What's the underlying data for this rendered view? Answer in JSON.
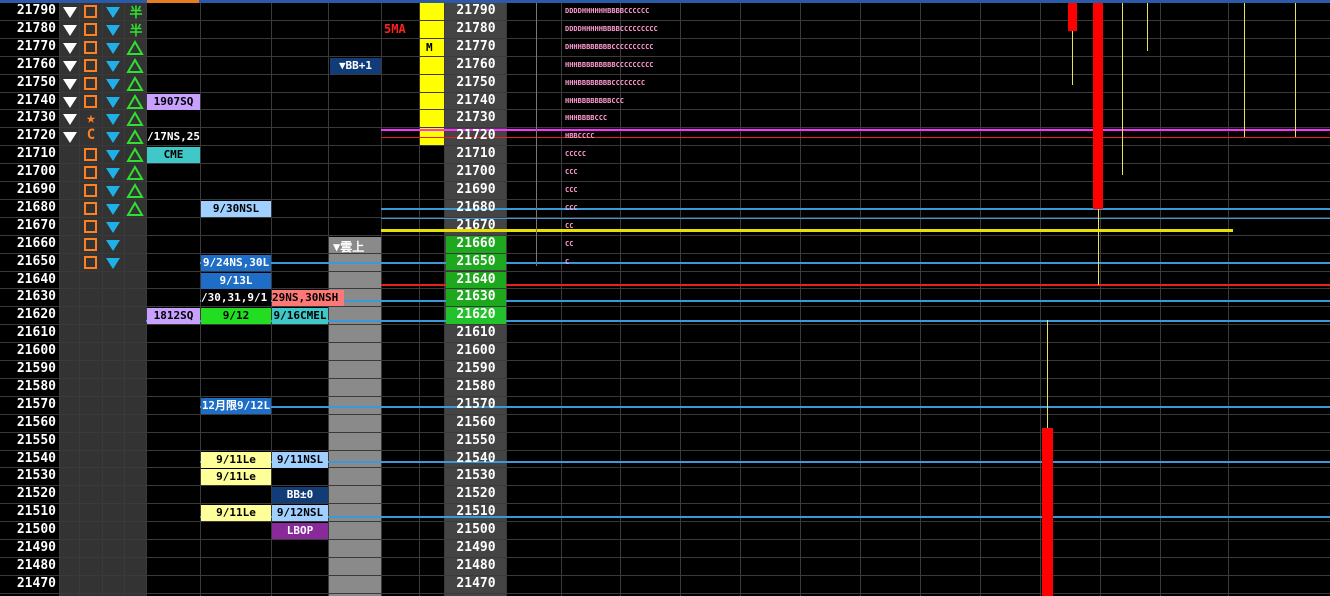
{
  "prices": [
    21790,
    21780,
    21770,
    21760,
    21750,
    21740,
    21730,
    21720,
    21710,
    21700,
    21690,
    21680,
    21670,
    21660,
    21650,
    21640,
    21630,
    21620,
    21610,
    21600,
    21590,
    21580,
    21570,
    21560,
    21550,
    21540,
    21530,
    21520,
    21510,
    21500,
    21490,
    21480,
    21470
  ],
  "highlight_prices": {
    "21660": "#1ea81e",
    "21650": "#1ea81e",
    "21640": "#1ea81e",
    "21630": "#1ea81e",
    "21620": "#22c22a"
  },
  "icon_rows": [
    {
      "c1": "down-tri",
      "c2": "square",
      "c3": "blue-tri",
      "c4": "yen"
    },
    {
      "c1": "down-tri",
      "c2": "square",
      "c3": "blue-tri",
      "c4": "yen"
    },
    {
      "c1": "down-tri",
      "c2": "square",
      "c3": "blue-tri",
      "c4": "up-tri"
    },
    {
      "c1": "down-tri",
      "c2": "square",
      "c3": "blue-tri",
      "c4": "up-tri"
    },
    {
      "c1": "down-tri",
      "c2": "square",
      "c3": "blue-tri",
      "c4": "up-tri"
    },
    {
      "c1": "down-tri",
      "c2": "square",
      "c3": "blue-tri",
      "c4": "up-tri"
    },
    {
      "c1": "down-tri",
      "c2": "star",
      "c3": "blue-tri",
      "c4": "up-tri"
    },
    {
      "c1": "down-tri",
      "c2": "C",
      "c3": "blue-tri",
      "c4": "up-tri"
    },
    {
      "c1": "",
      "c2": "square",
      "c3": "blue-tri",
      "c4": "up-tri"
    },
    {
      "c1": "",
      "c2": "square",
      "c3": "blue-tri",
      "c4": "up-tri"
    },
    {
      "c1": "",
      "c2": "square",
      "c3": "blue-tri",
      "c4": "up-tri"
    },
    {
      "c1": "",
      "c2": "square",
      "c3": "blue-tri",
      "c4": "up-tri"
    },
    {
      "c1": "",
      "c2": "square",
      "c3": "blue-tri",
      "c4": ""
    },
    {
      "c1": "",
      "c2": "square",
      "c3": "blue-tri",
      "c4": ""
    },
    {
      "c1": "",
      "c2": "square",
      "c3": "blue-tri",
      "c4": ""
    }
  ],
  "yen_char": "半",
  "c_char": "C",
  "star_char": "★",
  "tags": [
    {
      "col": "A",
      "row": 5,
      "text": "1907SQ",
      "bg": "#c8a0ff",
      "fg": "#000"
    },
    {
      "col": "A",
      "row": 7,
      "text": "/17NS,25",
      "bg": "#000",
      "fg": "#fff"
    },
    {
      "col": "A",
      "row": 8,
      "text": "CME",
      "bg": "#40c8c8",
      "fg": "#000"
    },
    {
      "col": "A",
      "row": 17,
      "text": "1812SQ",
      "bg": "#c8a0ff",
      "fg": "#000"
    },
    {
      "col": "B",
      "row": 11,
      "text": "9/30NSL",
      "bg": "#a0d0ff",
      "fg": "#000"
    },
    {
      "col": "B",
      "row": 14,
      "text": "9/24NS,30L",
      "bg": "#1e6ec8",
      "fg": "#fff"
    },
    {
      "col": "B",
      "row": 15,
      "text": "9/13L",
      "bg": "#1e6ec8",
      "fg": "#fff"
    },
    {
      "col": "B",
      "row": 17,
      "text": "9/12",
      "bg": "#22dd22",
      "fg": "#000"
    },
    {
      "col": "B",
      "row": 22,
      "text": "12月限9/12L",
      "bg": "#1e6ec8",
      "fg": "#fff"
    },
    {
      "col": "B",
      "row": 25,
      "text": "9/11Le",
      "bg": "#ffff99",
      "fg": "#000"
    },
    {
      "col": "B",
      "row": 26,
      "text": "9/11Le",
      "bg": "#ffff99",
      "fg": "#000"
    },
    {
      "col": "B",
      "row": 28,
      "text": "9/11Le",
      "bg": "#ffff99",
      "fg": "#000"
    },
    {
      "col": "C",
      "row": 17,
      "text": "9/16CMEL",
      "bg": "#40c8c8",
      "fg": "#000"
    },
    {
      "col": "C",
      "row": 25,
      "text": "9/11NSL",
      "bg": "#a0d0ff",
      "fg": "#000"
    },
    {
      "col": "C",
      "row": 27,
      "text": "BB±0",
      "bg": "#123c78",
      "fg": "#fff"
    },
    {
      "col": "C",
      "row": 28,
      "text": "9/12NSL",
      "bg": "#a0d0ff",
      "fg": "#000"
    },
    {
      "col": "C",
      "row": 29,
      "text": "LBOP",
      "bg": "#8a2a9a",
      "fg": "#fff"
    },
    {
      "col": "D",
      "row": 3,
      "text": "▼BB+1",
      "bg": "#123c78",
      "fg": "#fff"
    }
  ],
  "wide_tag": {
    "row": 16,
    "text_a": "/30,31,9/1",
    "text_b": "29NS,30NSH"
  },
  "gray_label": "▼雲上",
  "ma_label": "5MA",
  "m_label": "M",
  "tpo_rows": [
    "DDDDHHHHHHBBBBCCCCCC",
    "DDDDHHHHHBBBBCCCCCCCCC",
    "DHHHBBBBBBBCCCCCCCCCC",
    "HHHBBBBBBBBBCCCCCCCCC",
    "HHHBBBBBBBBCCCCCCCC",
    "HHHBBBBBBBBCCC",
    "HHHBBBBCCC",
    "HBBCCCC",
    "CCCCC",
    "CCC",
    "CCC",
    "CCC",
    "CC",
    "CC",
    "C"
  ],
  "colors": {
    "grid": "#3a3a3a",
    "blue_line": "#3a9ad8",
    "magenta_line": "#ff30ff",
    "yellow_line": "#e8e000",
    "red_line": "#e82020",
    "candle_red": "#ff0000"
  }
}
